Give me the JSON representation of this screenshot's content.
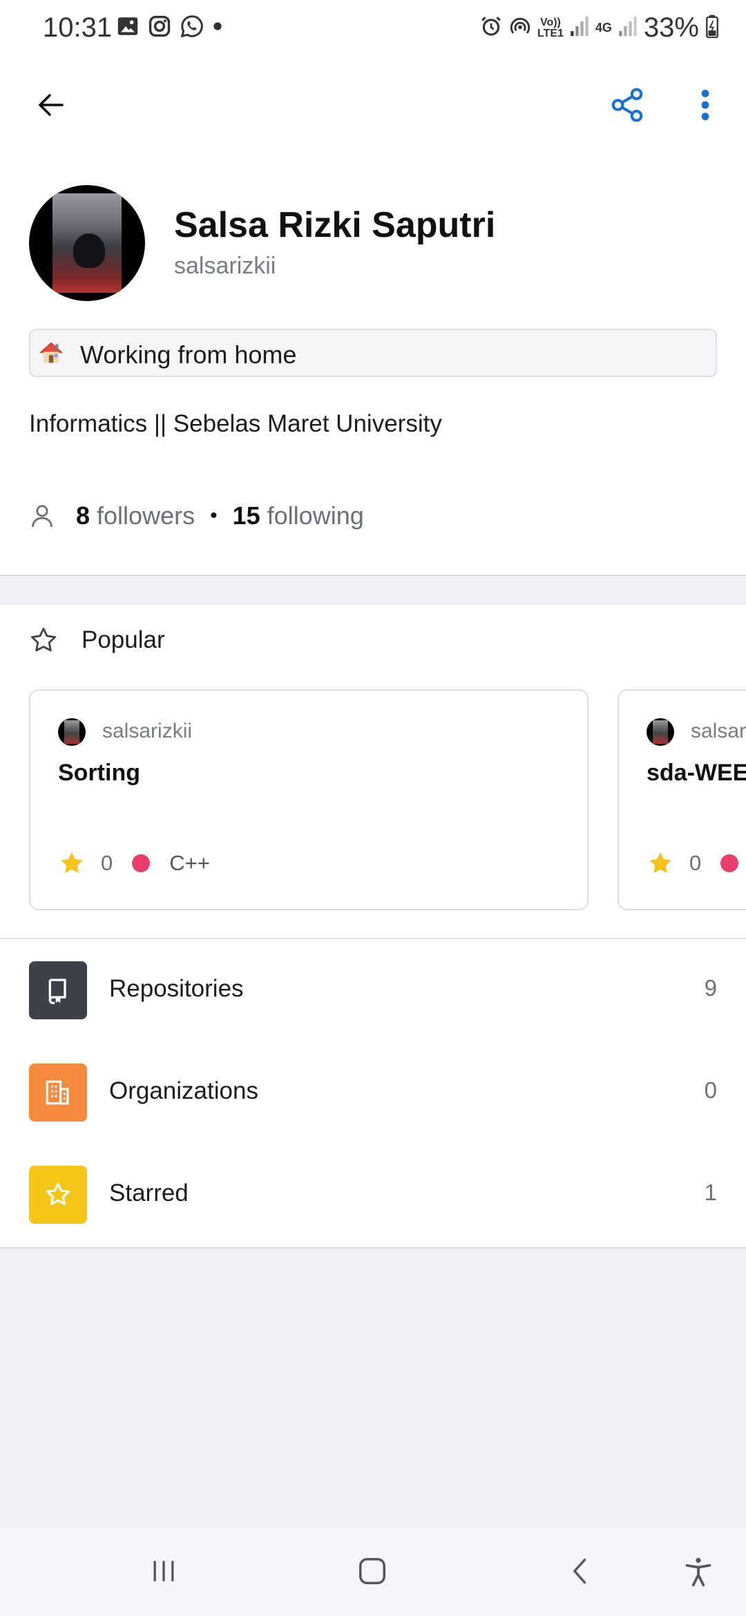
{
  "status_bar": {
    "time": "10:31",
    "battery": "33%",
    "left_icons": [
      "gallery-icon",
      "instagram-icon",
      "whatsapp-icon",
      "dot-icon"
    ],
    "right_icons": [
      "alarm-icon",
      "hotspot-icon",
      "volte-icon",
      "signal-icon",
      "4g-icon",
      "signal-icon",
      "battery-icon"
    ],
    "volte_text": "Vo)) LTE1",
    "network_text": "4G"
  },
  "appbar": {
    "back_icon": "arrow-left-icon",
    "share_icon": "share-icon",
    "more_icon": "more-vertical-icon",
    "accent": "#1a6fd4"
  },
  "profile": {
    "name": "Salsa Rizki Saputri",
    "login": "salsarizkii",
    "status_emoji": "house-icon",
    "status": "Working from home",
    "bio": "Informatics || Sebelas Maret University",
    "followers_count": "8",
    "followers_label": "followers",
    "following_count": "15",
    "following_label": "following"
  },
  "popular": {
    "title": "Popular",
    "repos": [
      {
        "owner": "salsarizkii",
        "name": "Sorting",
        "stars": "0",
        "language": "C++",
        "language_color": "#e83e6c"
      },
      {
        "owner": "salsarizkii",
        "name": "sda-WEEK",
        "stars": "0",
        "language": "",
        "language_color": "#e83e6c"
      }
    ]
  },
  "menu": [
    {
      "label": "Repositories",
      "count": "9",
      "color": "#3d4149",
      "icon": "repo-icon"
    },
    {
      "label": "Organizations",
      "count": "0",
      "color": "#f68a3c",
      "icon": "organization-icon"
    },
    {
      "label": "Starred",
      "count": "1",
      "color": "#f5c518",
      "icon": "star-icon"
    }
  ],
  "navbar": {
    "icons": [
      "recents-icon",
      "home-icon",
      "back-icon",
      "accessibility-icon"
    ]
  }
}
